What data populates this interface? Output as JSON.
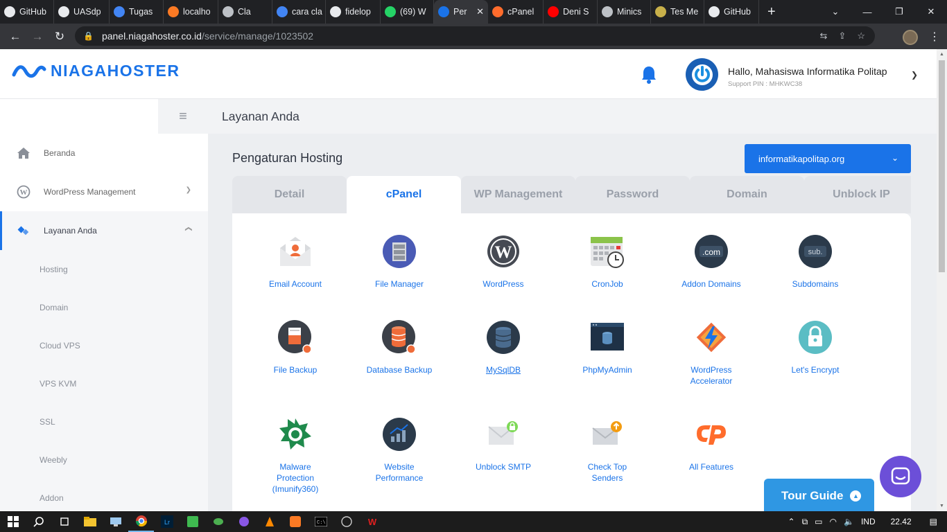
{
  "browser": {
    "tabs": [
      {
        "label": "GitHub",
        "fav": "github-icon",
        "color": "#e8eaed"
      },
      {
        "label": "UASdp",
        "fav": "github-icon",
        "color": "#e8eaed"
      },
      {
        "label": "Tugas",
        "fav": "classroom-icon",
        "color": "#4285f4"
      },
      {
        "label": "localho",
        "fav": "xampp-icon",
        "color": "#fb7a24"
      },
      {
        "label": "Cla",
        "fav": "globe-icon",
        "color": "#bdc1c6"
      },
      {
        "label": "cara cla",
        "fav": "google-icon",
        "color": "#4285f4"
      },
      {
        "label": "fidelop",
        "fav": "shield-icon",
        "color": "#e8eaed"
      },
      {
        "label": "(69) W",
        "fav": "whatsapp-icon",
        "color": "#25d366"
      },
      {
        "label": "Per",
        "fav": "niagahoster-icon",
        "color": "#1a73e8",
        "active": true
      },
      {
        "label": "cPanel",
        "fav": "cpanel-icon",
        "color": "#ff6c2c"
      },
      {
        "label": "Deni S",
        "fav": "youtube-icon",
        "color": "#ff0000"
      },
      {
        "label": "Minics",
        "fav": "globe-icon",
        "color": "#bdc1c6"
      },
      {
        "label": "Tes Me",
        "fav": "badge-icon",
        "color": "#c8b04a"
      },
      {
        "label": "GitHub",
        "fav": "github-icon",
        "color": "#e8eaed"
      }
    ],
    "url_host": "panel.niagahoster.co.id",
    "url_path": "/service/manage/1023502"
  },
  "header": {
    "logo": "NIAGAHOSTER",
    "greeting": "Hallo, Mahasiswa Informatika Politap",
    "pin": "Support PIN : MHKWC38"
  },
  "sidebar": {
    "items": [
      {
        "label": "Beranda",
        "icon": "home-icon"
      },
      {
        "label": "WordPress Management",
        "icon": "wordpress-icon"
      },
      {
        "label": "Layanan Anda",
        "icon": "services-icon"
      }
    ],
    "subitems": [
      "Hosting",
      "Domain",
      "Cloud VPS",
      "VPS KVM",
      "SSL",
      "Weebly",
      "Addon"
    ]
  },
  "breadcrumb": "Layanan Anda",
  "main": {
    "title": "Pengaturan Hosting",
    "domain_select": "informatikapolitap.org",
    "tabs": [
      "Detail",
      "cPanel",
      "WP Management",
      "Password",
      "Domain",
      "Unblock IP"
    ],
    "active_tab": "cPanel",
    "features": [
      {
        "label": "Email Account",
        "icon": "email-account-icon"
      },
      {
        "label": "File Manager",
        "icon": "file-manager-icon"
      },
      {
        "label": "WordPress",
        "icon": "wordpress-icon"
      },
      {
        "label": "CronJob",
        "icon": "cronjob-icon"
      },
      {
        "label": "Addon Domains",
        "icon": "addon-domains-icon"
      },
      {
        "label": "Subdomains",
        "icon": "subdomains-icon"
      },
      {
        "label": "File Backup",
        "icon": "file-backup-icon"
      },
      {
        "label": "Database Backup",
        "icon": "database-backup-icon"
      },
      {
        "label": "MySqlDB",
        "icon": "mysql-icon"
      },
      {
        "label": "PhpMyAdmin",
        "icon": "phpmyadmin-icon"
      },
      {
        "label": "WordPress Accelerator",
        "icon": "accelerator-icon"
      },
      {
        "label": "Let's Encrypt",
        "icon": "lock-icon"
      },
      {
        "label": "Malware Protection (Imunify360)",
        "icon": "malware-icon"
      },
      {
        "label": "Website Performance",
        "icon": "performance-icon"
      },
      {
        "label": "Unblock SMTP",
        "icon": "smtp-icon"
      },
      {
        "label": "Check Top Senders",
        "icon": "senders-icon"
      },
      {
        "label": "All Features",
        "icon": "cpanel-icon"
      }
    ]
  },
  "tour_guide": "Tour Guide",
  "taskbar": {
    "lang": "IND",
    "time": "22.42"
  },
  "colors": {
    "accent": "#1a73e8",
    "chat": "#6c4fd8",
    "tour": "#2f97e3"
  }
}
